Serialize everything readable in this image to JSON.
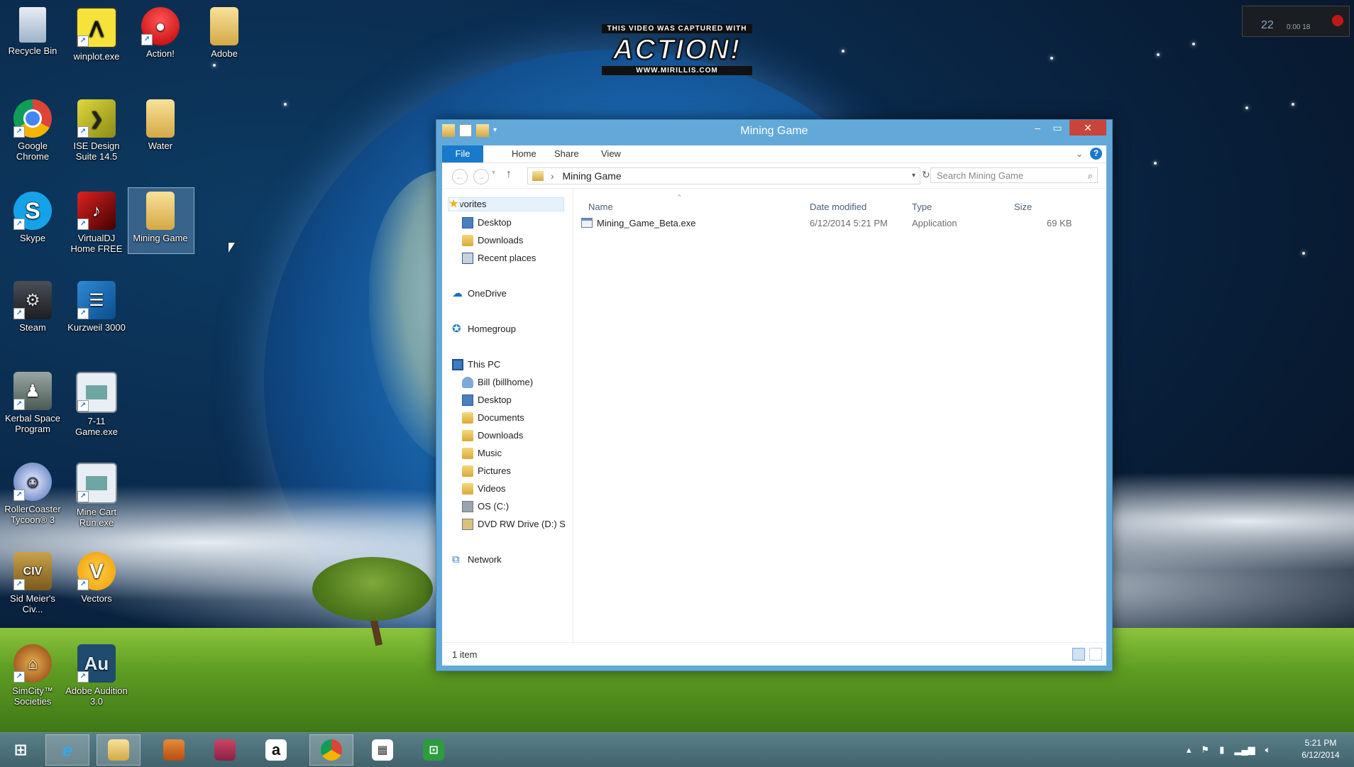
{
  "watermark": {
    "top": "THIS VIDEO WAS CAPTURED WITH",
    "logo": "ACTION!",
    "url": "WWW.MIRILLIS.COM"
  },
  "desktop_icons": [
    {
      "label": "Recycle Bin",
      "icon": "recycle-bin-icon"
    },
    {
      "label": "winplot.exe",
      "icon": "winplot-icon"
    },
    {
      "label": "Action!",
      "icon": "action-icon"
    },
    {
      "label": "Adobe",
      "icon": "folder-icon"
    },
    {
      "label": "Google Chrome",
      "icon": "chrome-icon"
    },
    {
      "label": "ISE Design Suite 14.5",
      "icon": "ise-icon"
    },
    {
      "label": "Water",
      "icon": "folder-icon"
    },
    {
      "label": "Skype",
      "icon": "skype-icon"
    },
    {
      "label": "VirtualDJ Home FREE",
      "icon": "virtualdj-icon"
    },
    {
      "label": "Mining Game",
      "icon": "folder-icon"
    },
    {
      "label": "Steam",
      "icon": "steam-icon"
    },
    {
      "label": "Kurzweil 3000",
      "icon": "kurzweil-icon"
    },
    {
      "label": "Kerbal Space Program",
      "icon": "kerbal-icon"
    },
    {
      "label": "7-11 Game.exe",
      "icon": "exe-icon"
    },
    {
      "label": "RollerCoaster Tycoon® 3",
      "icon": "rct-icon"
    },
    {
      "label": "Mine Cart Run.exe",
      "icon": "exe-icon"
    },
    {
      "label": "Sid Meier's Civ...",
      "icon": "civ-icon"
    },
    {
      "label": "Vectors",
      "icon": "v-icon"
    },
    {
      "label": "SimCity™ Societies",
      "icon": "simcity-icon"
    },
    {
      "label": "Adobe Audition 3.0",
      "icon": "audition-icon"
    }
  ],
  "meter": {
    "value": "22",
    "sub": "0:00 18"
  },
  "window": {
    "title": "Mining Game",
    "tabs": {
      "file": "File",
      "home": "Home",
      "share": "Share",
      "view": "View"
    },
    "address": "Mining Game",
    "search_placeholder": "Search Mining Game",
    "nav": {
      "favorites": "Favorites",
      "desktop": "Desktop",
      "downloads": "Downloads",
      "recent": "Recent places",
      "onedrive": "OneDrive",
      "homegroup": "Homegroup",
      "thispc": "This PC",
      "user": "Bill (billhome)",
      "pc_desktop": "Desktop",
      "documents": "Documents",
      "pc_downloads": "Downloads",
      "music": "Music",
      "pictures": "Pictures",
      "videos": "Videos",
      "osc": "OS (C:)",
      "dvd": "DVD RW Drive (D:) S",
      "network": "Network"
    },
    "columns": {
      "name": "Name",
      "date": "Date modified",
      "type": "Type",
      "size": "Size"
    },
    "files": [
      {
        "name": "Mining_Game_Beta.exe",
        "date": "6/12/2014 5:21 PM",
        "type": "Application",
        "size": "69 KB"
      }
    ],
    "status": "1 item"
  },
  "taskbar": {
    "items": [
      "start-icon",
      "internet-explorer-icon",
      "file-explorer-icon",
      "app-icon",
      "app-icon-2",
      "amazon-icon",
      "chrome-icon",
      "apps-grid-icon",
      "store-icon"
    ],
    "clock_time": "5:21 PM",
    "clock_date": "6/12/2014"
  }
}
